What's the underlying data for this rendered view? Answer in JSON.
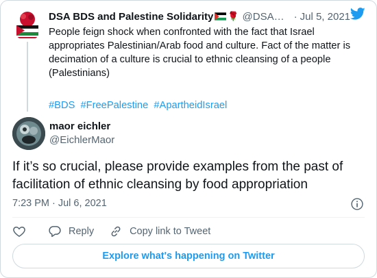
{
  "parent_tweet": {
    "author_name": "DSA BDS and Palestine Solidarity",
    "handle": "@DSA…",
    "date": "Jul 5, 2021",
    "text_lines": [
      "People feign shock when confronted with the fact that Israel",
      "appropriates Palestinian/Arab food and culture. Fact of the matter is",
      "decimation of a culture is crucial to ethnic cleansing of a people",
      "(Palestinians)"
    ],
    "hashtags": [
      "#BDS",
      "#FreePalestine",
      "#ApartheidIsrael"
    ]
  },
  "reply_tweet": {
    "author_name": "maor eichler",
    "handle": "@EichlerMaor",
    "text_lines": [
      "If it’s so crucial, please provide examples from the past of",
      "facilitation of ethnic cleansing by food appropriation"
    ],
    "time": "7:23 PM",
    "date": "Jul 6, 2021"
  },
  "actions": {
    "reply_label": "Reply",
    "copy_link_label": "Copy link to Tweet"
  },
  "explore_button_label": "Explore what's happening on Twitter",
  "colors": {
    "accent": "#1d9bf0",
    "text": "#0f1419",
    "secondary": "#536471",
    "border": "#cfd9de"
  },
  "icons": [
    "twitter-bird-icon",
    "info-icon",
    "heart-icon",
    "reply-icon",
    "link-icon",
    "palestine-flag-icon",
    "rose-icon"
  ]
}
